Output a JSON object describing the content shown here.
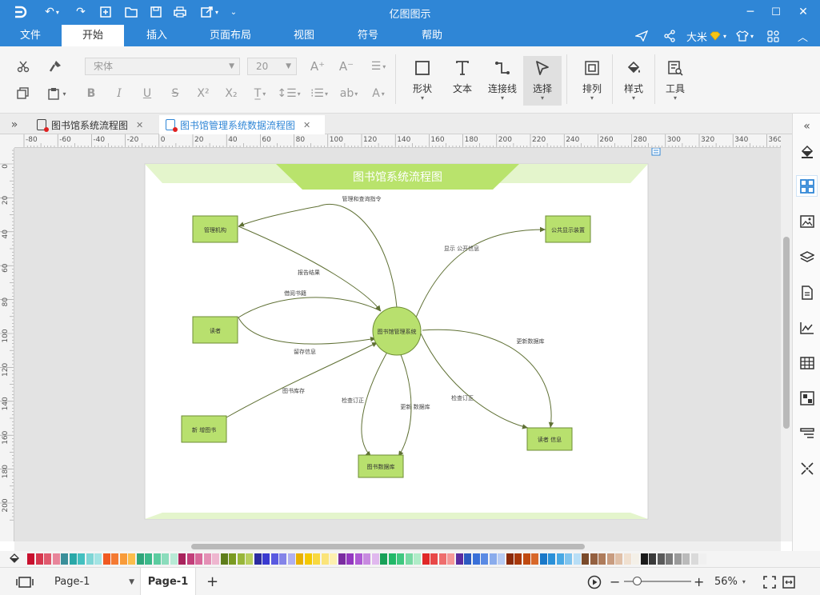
{
  "app": {
    "title": "亿图图示"
  },
  "menu": {
    "items": [
      "文件",
      "开始",
      "插入",
      "页面布局",
      "视图",
      "符号",
      "帮助"
    ],
    "active_index": 1
  },
  "user": {
    "name": "大米"
  },
  "ribbon": {
    "font_name": "宋体",
    "font_size": "20",
    "bold": "B",
    "italic": "I",
    "underline": "U",
    "strike": "S",
    "sup": "X²",
    "sub": "X₂",
    "big": {
      "shape": "形状",
      "text": "文本",
      "connector": "连接线",
      "select": "选择",
      "arrange": "排列",
      "style": "样式",
      "tools": "工具"
    }
  },
  "tabs": [
    {
      "title": "图书馆系统流程图"
    },
    {
      "title": "图书馆管理系统数据流程图"
    }
  ],
  "ruler": {
    "h_labels": [
      "-80",
      "-60",
      "-40",
      "-20",
      "0",
      "20",
      "40",
      "60",
      "80",
      "100",
      "120",
      "140",
      "160",
      "180",
      "200",
      "220",
      "240",
      "260",
      "280",
      "300",
      "320",
      "340",
      "360"
    ],
    "v_labels": [
      "0",
      "20",
      "40",
      "60",
      "80",
      "100",
      "120",
      "140",
      "160",
      "180",
      "200"
    ]
  },
  "diagram": {
    "title": "图书馆系统流程图",
    "center": "图书馆管理系统",
    "boxes": {
      "org": "管理机构",
      "reader": "读者",
      "newbook": "新 增图书",
      "public": "公共显示装置",
      "readerinfo": "读者 信息",
      "bookdb": "图书数据库"
    },
    "flows": {
      "mgmt_query": "管理和查询指令",
      "report": "报告结果",
      "borrow": "借阅书籍",
      "leave_info": "留存信息",
      "stock": "图书库存",
      "check_order_1": "检查订正",
      "update_db_1": "更新 数据库",
      "show_public": "显示 公开信息",
      "update_db_2": "更新数据库",
      "check_order_2": "检查订正"
    },
    "colors": {
      "box_fill": "#b8e06e",
      "box_stroke": "#6e8c35",
      "line": "#5f7034",
      "band": "#b9e36c",
      "band_light": "#e4f5cc"
    }
  },
  "palette": [
    "#c8102e",
    "#d6374e",
    "#e05a6e",
    "#e8859a",
    "#3a8f9a",
    "#2aa8a8",
    "#44c0c0",
    "#7fd6d6",
    "#a3e4e4",
    "#f05a22",
    "#f47a33",
    "#f89b3a",
    "#fbbd4c",
    "#2ea57a",
    "#3cb98a",
    "#5ccca0",
    "#8bdcbc",
    "#b8ead6",
    "#a8235c",
    "#c23f7a",
    "#d8689a",
    "#e48fb5",
    "#eeb6cf",
    "#5e7d1a",
    "#7a9a22",
    "#98b63a",
    "#b8cf5e",
    "#2c2ca0",
    "#3a3ad0",
    "#5a5ae0",
    "#8484e8",
    "#b0b0f0",
    "#e8b000",
    "#f4c800",
    "#f8d840",
    "#fbe47a",
    "#fdf0b0",
    "#7a2ca0",
    "#9438c0",
    "#ae5ad4",
    "#c88ae0",
    "#e0b8ee",
    "#18a058",
    "#22b868",
    "#40c880",
    "#78daa4",
    "#b0ecc8",
    "#e02828",
    "#e84848",
    "#ee6e6e",
    "#f49898",
    "#5a2ca0",
    "#2c5ac0",
    "#3a70d8",
    "#5a8ae4",
    "#8aacec",
    "#b8ccf4",
    "#8a2a0a",
    "#a8380a",
    "#c04a10",
    "#d8682a",
    "#1a78c8",
    "#2a90d8",
    "#48a8e4",
    "#80c4ee",
    "#b8def6",
    "#7a4a2a",
    "#946040",
    "#ae7c5c",
    "#c89c80",
    "#e0c0a8",
    "#f0e0d0",
    "#f4f0e8",
    "#1a1a1a",
    "#3a3a3a",
    "#5a5a5a",
    "#7a7a7a",
    "#9a9a9a",
    "#bababa",
    "#dadada",
    "#f0f0f0"
  ],
  "status": {
    "page_selector": "Page-1",
    "page_tab": "Page-1",
    "zoom": "56%",
    "zoom_fraction": 0.2
  }
}
